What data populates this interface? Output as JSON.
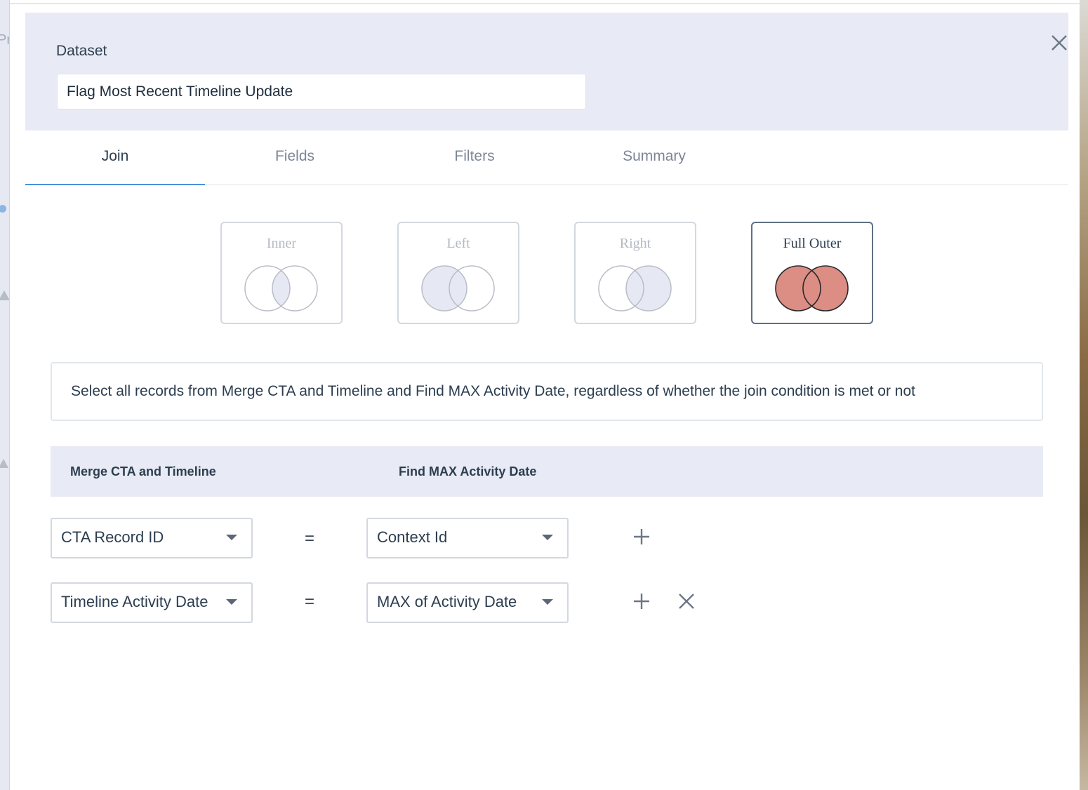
{
  "background": {
    "left_fragment_text": "Pr"
  },
  "header": {
    "dataset_label": "Dataset",
    "dataset_name": "Flag Most Recent Timeline Update",
    "close_icon": "close-icon"
  },
  "tabs": [
    {
      "label": "Join",
      "active": true
    },
    {
      "label": "Fields",
      "active": false
    },
    {
      "label": "Filters",
      "active": false
    },
    {
      "label": "Summary",
      "active": false
    }
  ],
  "join_types": [
    {
      "label": "Inner",
      "selected": false
    },
    {
      "label": "Left",
      "selected": false
    },
    {
      "label": "Right",
      "selected": false
    },
    {
      "label": "Full Outer",
      "selected": true
    }
  ],
  "description": "Select all records from Merge CTA and Timeline and Find MAX Activity Date, regardless of whether the join condition is met or not",
  "conditions": {
    "left_header": "Merge CTA and Timeline",
    "right_header": "Find MAX Activity Date",
    "rows": [
      {
        "left_field": "CTA Record ID",
        "operator": "=",
        "right_field": "Context Id",
        "can_remove": false
      },
      {
        "left_field": "Timeline Activity Date",
        "operator": "=",
        "right_field": "MAX of Activity Date",
        "can_remove": true
      }
    ]
  },
  "colors": {
    "accent": "#4a8fdc",
    "selected_fill": "#dc8e84",
    "venn_fill": "#e6e8f3",
    "header_bg": "#e8ebf5"
  }
}
